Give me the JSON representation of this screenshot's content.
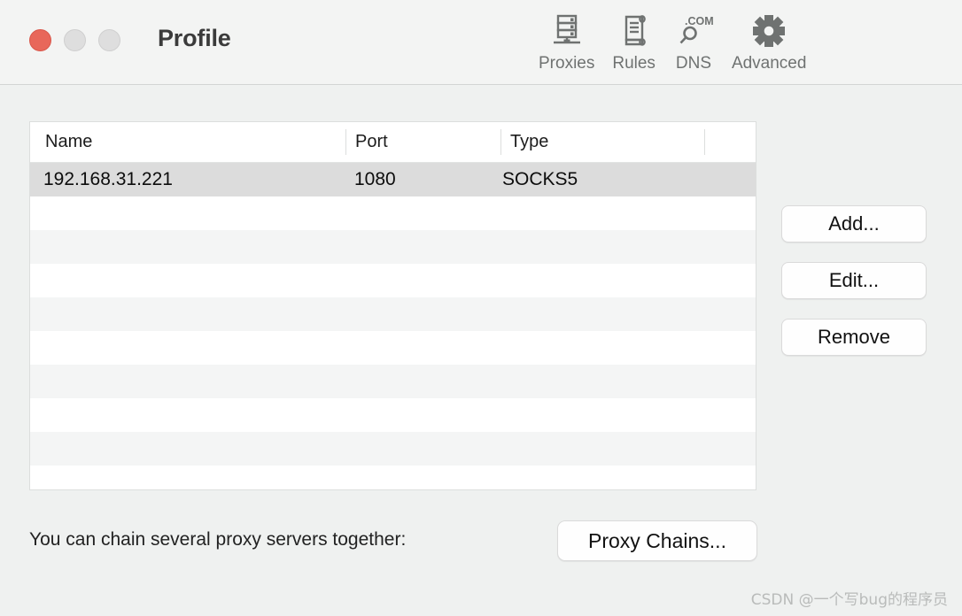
{
  "window": {
    "title": "Profile",
    "traffic_lights": [
      {
        "name": "close",
        "color": "#e8675a"
      },
      {
        "name": "minimize",
        "color": "#dedede"
      },
      {
        "name": "zoom",
        "color": "#dedede"
      }
    ]
  },
  "toolbar": {
    "items": [
      {
        "label": "Proxies",
        "icon": "server-rack-icon"
      },
      {
        "label": "Rules",
        "icon": "scroll-document-icon"
      },
      {
        "label": "DNS",
        "icon": "dot-com-magnifier-icon"
      },
      {
        "label": "Advanced",
        "icon": "gear-icon"
      }
    ]
  },
  "table": {
    "columns": [
      {
        "key": "name",
        "label": "Name"
      },
      {
        "key": "port",
        "label": "Port"
      },
      {
        "key": "type",
        "label": "Type"
      },
      {
        "key": "extra",
        "label": ""
      }
    ],
    "rows": [
      {
        "name": "192.168.31.221",
        "port": "1080",
        "type": "SOCKS5",
        "selected": true
      },
      {
        "name": "",
        "port": "",
        "type": "",
        "selected": false
      },
      {
        "name": "",
        "port": "",
        "type": "",
        "selected": false
      },
      {
        "name": "",
        "port": "",
        "type": "",
        "selected": false
      },
      {
        "name": "",
        "port": "",
        "type": "",
        "selected": false
      },
      {
        "name": "",
        "port": "",
        "type": "",
        "selected": false
      },
      {
        "name": "",
        "port": "",
        "type": "",
        "selected": false
      },
      {
        "name": "",
        "port": "",
        "type": "",
        "selected": false
      },
      {
        "name": "",
        "port": "",
        "type": "",
        "selected": false
      },
      {
        "name": "",
        "port": "",
        "type": "",
        "selected": false
      }
    ]
  },
  "side_buttons": [
    {
      "label": "Add...",
      "name": "add-button"
    },
    {
      "label": "Edit...",
      "name": "edit-button"
    },
    {
      "label": "Remove",
      "name": "remove-button"
    }
  ],
  "footer": {
    "chain_text": "You can chain several proxy servers together:",
    "proxy_chains_label": "Proxy Chains..."
  },
  "watermark": {
    "text": "CSDN @一个写bug的程序员"
  },
  "colors": {
    "window_bg": "#eff1f0",
    "titlebar_bg": "#f3f4f3",
    "close_red": "#e8675a",
    "selection_gray": "#dcdcdc",
    "stripe_gray": "#f4f5f5",
    "icon_gray": "#6f7271"
  }
}
